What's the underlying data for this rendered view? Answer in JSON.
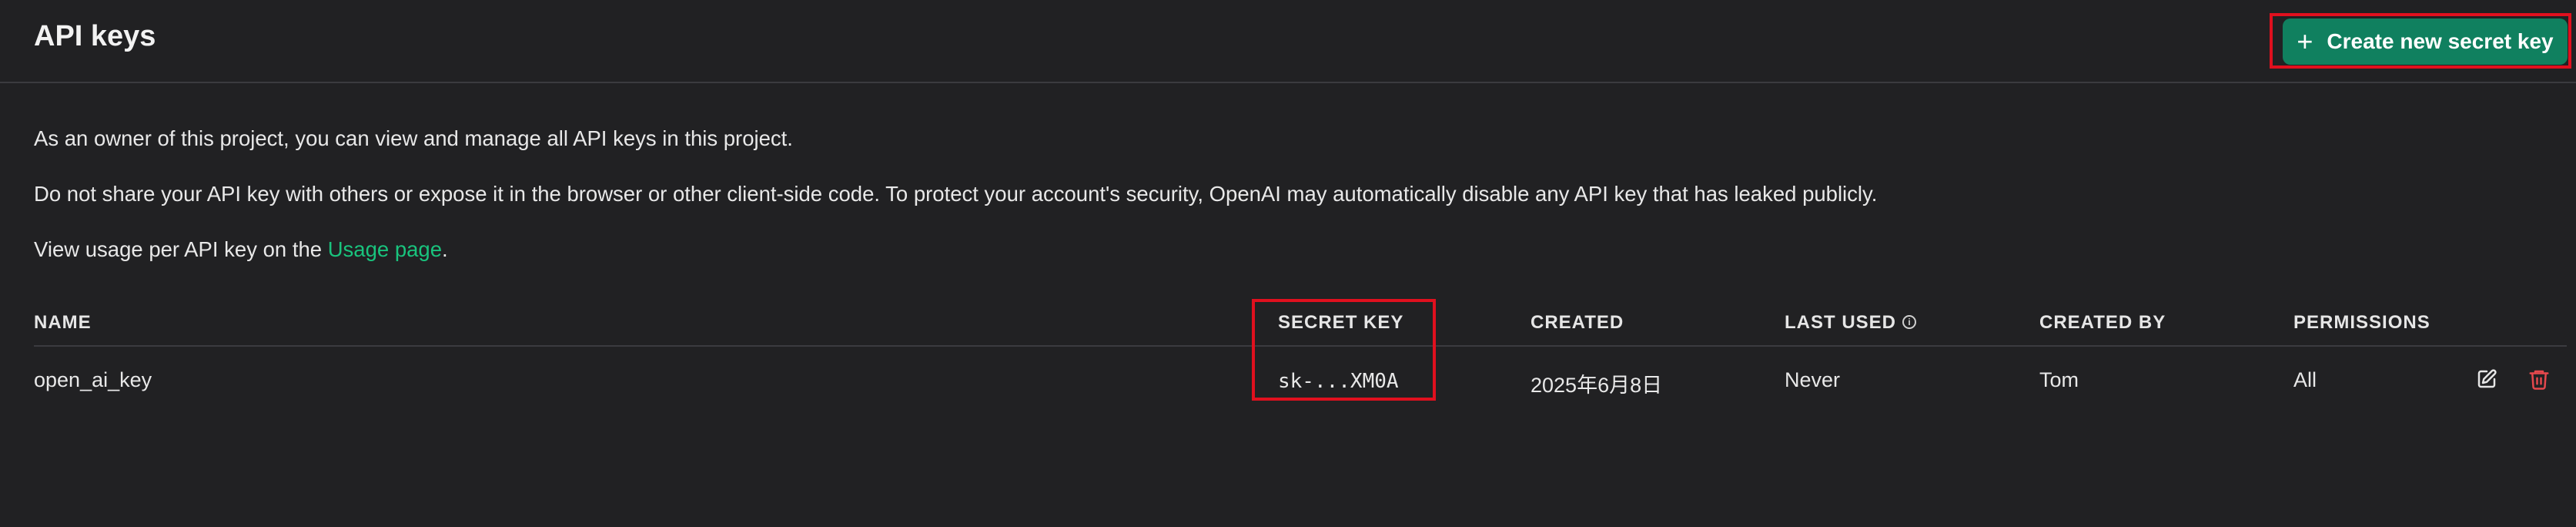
{
  "header": {
    "title": "API keys",
    "create_button_label": "Create new secret key",
    "plus_icon": "+"
  },
  "descriptions": {
    "owner_text": "As an owner of this project, you can view and manage all API keys in this project.",
    "warning_text": "Do not share your API key with others or expose it in the browser or other client-side code. To protect your account's security, OpenAI may automatically disable any API key that has leaked publicly.",
    "usage_prefix": "View usage per API key on the ",
    "usage_link": "Usage page",
    "usage_suffix": "."
  },
  "table": {
    "columns": {
      "name": "NAME",
      "secret_key": "SECRET KEY",
      "created": "CREATED",
      "last_used": "LAST USED",
      "created_by": "CREATED BY",
      "permissions": "PERMISSIONS"
    },
    "info_icon": "i",
    "rows": [
      {
        "name": "open_ai_key",
        "secret_key": "sk-...XM0A",
        "created": "2025年6月8日",
        "last_used": "Never",
        "created_by": "Tom",
        "permissions": "All"
      }
    ]
  },
  "colors": {
    "background": "#212123",
    "accent": "#10805f",
    "link": "#19c37d",
    "delete": "#e5484d",
    "highlight_box": "#e0101e"
  },
  "icons": {
    "create": "plus-icon",
    "edit": "edit-icon",
    "delete": "trash-icon",
    "info": "info-icon"
  }
}
